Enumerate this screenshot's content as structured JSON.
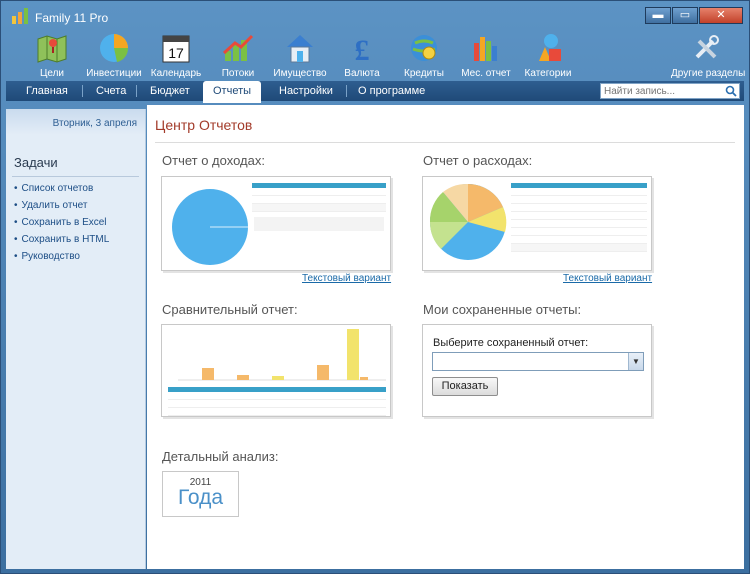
{
  "window": {
    "title": "Family 11 Pro",
    "controls": [
      "▬",
      "▭",
      "✕"
    ]
  },
  "toolbar": {
    "items": [
      {
        "label": "Цели",
        "icon": "map-icon"
      },
      {
        "label": "Инвестиции",
        "icon": "pie-chart-icon"
      },
      {
        "label": "Календарь",
        "icon": "calendar-icon"
      },
      {
        "label": "Потоки",
        "icon": "growth-chart-icon"
      },
      {
        "label": "Имущество",
        "icon": "house-icon"
      },
      {
        "label": "Валюта",
        "icon": "pound-icon"
      },
      {
        "label": "Кредиты",
        "icon": "globe-money-icon"
      },
      {
        "label": "Мес. отчет",
        "icon": "bar-chart-icon"
      },
      {
        "label": "Категории",
        "icon": "shapes-icon"
      },
      {
        "label": "Другие разделы",
        "icon": "tools-icon"
      }
    ],
    "calendar_day": "17"
  },
  "nav": {
    "tabs": [
      "Главная",
      "Счета",
      "Бюджет",
      "Отчеты",
      "Настройки",
      "О программе"
    ],
    "active": "Отчеты",
    "search_placeholder": "Найти запись..."
  },
  "sidebar": {
    "date": "Вторник, 3 апреля",
    "heading": "Задачи",
    "links": [
      "Список отчетов",
      "Удалить отчет",
      "Сохранить в Excel",
      "Сохранить в HTML",
      "Руководство"
    ]
  },
  "main": {
    "title": "Центр Отчетов",
    "income": {
      "title": "Отчет о доходах:",
      "link": "Текстовый вариант"
    },
    "expense": {
      "title": "Отчет о расходах:",
      "link": "Текстовый вариант"
    },
    "compare": {
      "title": "Сравнительный отчет:"
    },
    "saved": {
      "title": "Мои сохраненные отчеты:",
      "label": "Выберите сохраненный отчет:",
      "select_value": "",
      "button": "Показать"
    },
    "detail": {
      "title": "Детальный анализ:",
      "year": "2011",
      "word": "Года"
    }
  },
  "colors": {
    "accent": "#3c6fa0",
    "title_red": "#a33b2a",
    "link_blue": "#1a6aa8",
    "table_header": "#38a0c8",
    "bar_orange": "#f5b96a",
    "bar_yellow": "#f2e36c",
    "pie_blue": "#4fb1ec"
  }
}
